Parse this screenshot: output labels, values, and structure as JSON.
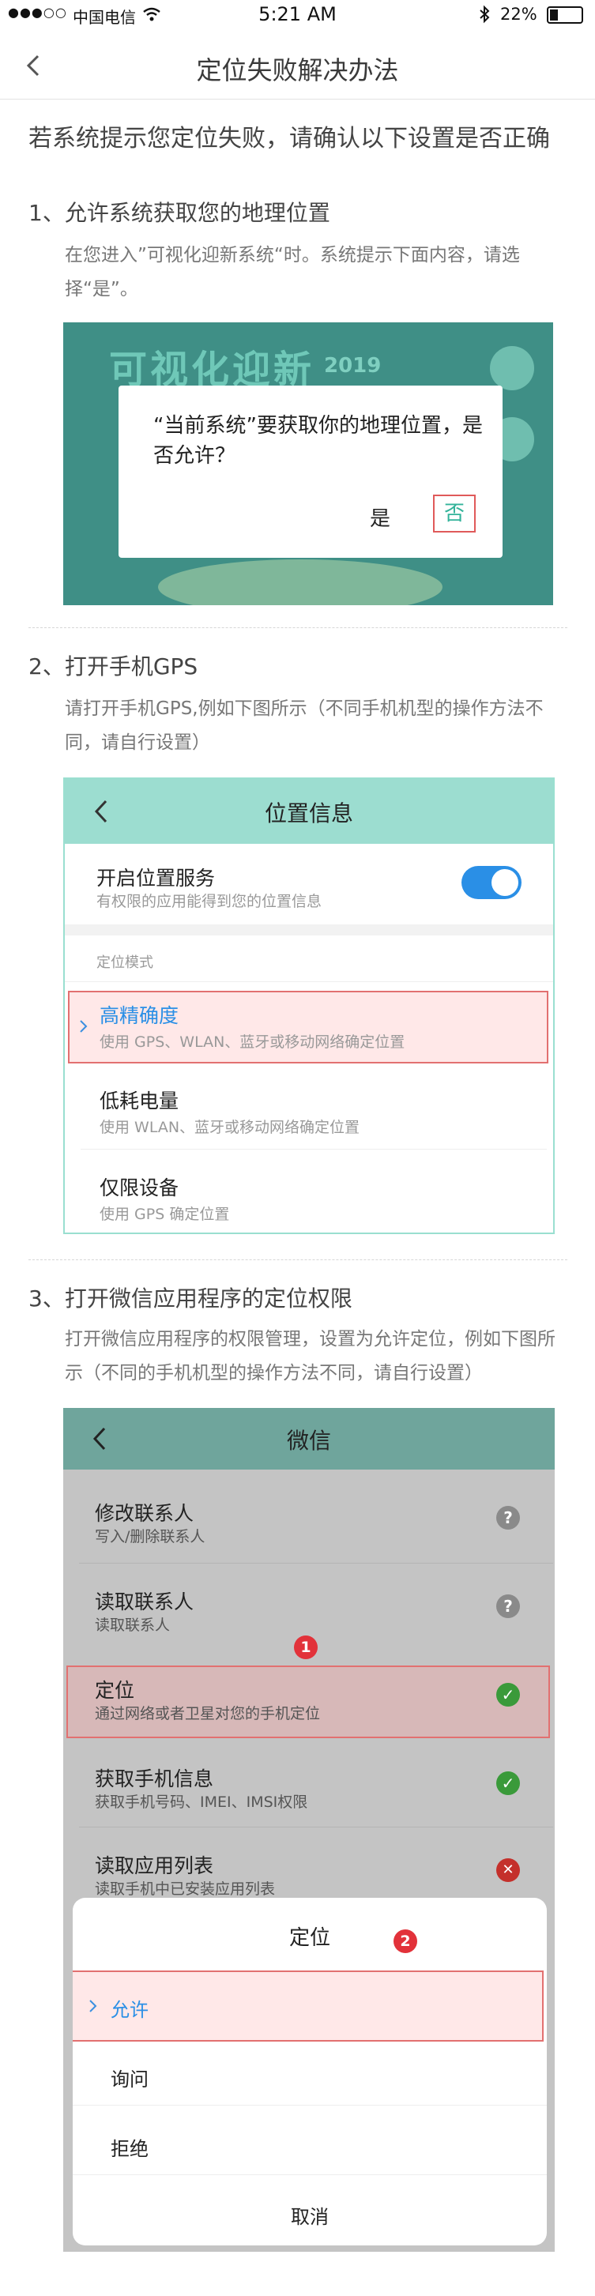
{
  "status": {
    "signal": "●●●○○",
    "carrier": "中国电信",
    "time": "5:21 AM",
    "battery": "22%"
  },
  "nav": {
    "title": "定位失败解决办法"
  },
  "heading": "若系统提示您定位失败，请确认以下设置是否正确",
  "section1": {
    "title": "1、允许系统获取您的地理位置",
    "desc": "在您进入”可视化迎新系统“时。系统提示下面内容，请选择“是”。",
    "shot": {
      "bg_title": "可视化迎新",
      "bg_year": "2019",
      "dialog_text": "“当前系统”要获取你的地理位置，是否允许？",
      "yes": "是",
      "no": "否"
    }
  },
  "section2": {
    "title": "2、打开手机GPS",
    "desc": "请打开手机GPS,例如下图所示（不同手机机型的操作方法不同，请自行设置）",
    "shot": {
      "header": "位置信息",
      "service_title": "开启位置服务",
      "service_sub": "有权限的应用能得到您的位置信息",
      "mode_label": "定位模式",
      "modes": [
        {
          "title": "高精确度",
          "sub": "使用 GPS、WLAN、蓝牙或移动网络确定位置"
        },
        {
          "title": "低耗电量",
          "sub": "使用 WLAN、蓝牙或移动网络确定位置"
        },
        {
          "title": "仅限设备",
          "sub": "使用 GPS 确定位置"
        }
      ]
    }
  },
  "section3": {
    "title": "3、打开微信应用程序的定位权限",
    "desc": "打开微信应用程序的权限管理，设置为允许定位，例如下图所示（不同的手机机型的操作方法不同，请自行设置）",
    "shot": {
      "header": "微信",
      "perms": [
        {
          "title": "修改联系人",
          "sub": "写入/删除联系人"
        },
        {
          "title": "读取联系人",
          "sub": "读取联系人"
        },
        {
          "title": "定位",
          "sub": "通过网络或者卫星对您的手机定位"
        },
        {
          "title": "获取手机信息",
          "sub": "获取手机号码、IMEI、IMSI权限"
        },
        {
          "title": "读取应用列表",
          "sub": "读取手机中已安装应用列表"
        }
      ],
      "badge1": "1",
      "badge2": "2",
      "sheet_title": "定位",
      "options": [
        "允许",
        "询问",
        "拒绝"
      ],
      "cancel": "取消"
    }
  },
  "colors": {
    "accent": "#33b39a",
    "highlight": "#e27070",
    "toggle": "#2a8fe6"
  }
}
